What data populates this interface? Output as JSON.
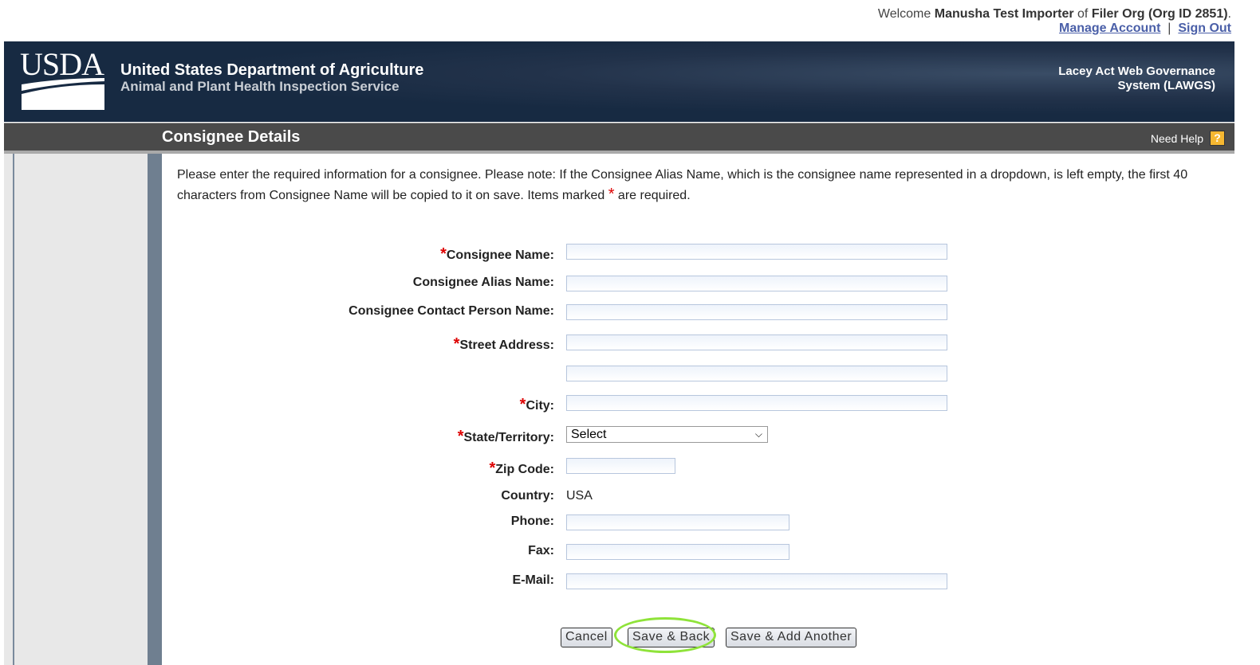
{
  "header": {
    "welcome": "Welcome",
    "user": "Manusha Test Importer",
    "of": "of",
    "org": "Filer Org (Org ID 2851)",
    "period": ".",
    "manage_account": "Manage Account",
    "sep": "|",
    "sign_out": "Sign Out"
  },
  "banner": {
    "logo": "USDA",
    "agency": "United States Department of Agriculture",
    "service": "Animal and Plant Health Inspection Service",
    "system_line1": "Lacey Act Web Governance",
    "system_line2": "System (LAWGS)"
  },
  "titlebar": {
    "title": "Consignee Details",
    "help": "Need Help",
    "help_icon": "?"
  },
  "intro": {
    "text": "Please enter the required information for a consignee. Please note: If the Consignee Alias Name, which is the consignee name represented in a dropdown, is left empty, the first 40 characters from Consignee Name will be copied to it on save.  Items marked",
    "req": "*",
    "tail": " are required."
  },
  "form": {
    "consignee_name": "Consignee Name:",
    "alias_name": "Consignee Alias Name:",
    "contact_name": "Consignee Contact Person Name:",
    "street": "Street Address:",
    "city": "City:",
    "state": "State/Territory:",
    "state_value": "Select",
    "zip": "Zip Code:",
    "country": "Country:",
    "country_value": "USA",
    "phone": "Phone:",
    "fax": "Fax:",
    "email": "E-Mail:",
    "req": "*"
  },
  "buttons": {
    "cancel": "Cancel",
    "save_back": "Save & Back",
    "save_add": "Save & Add Another"
  }
}
